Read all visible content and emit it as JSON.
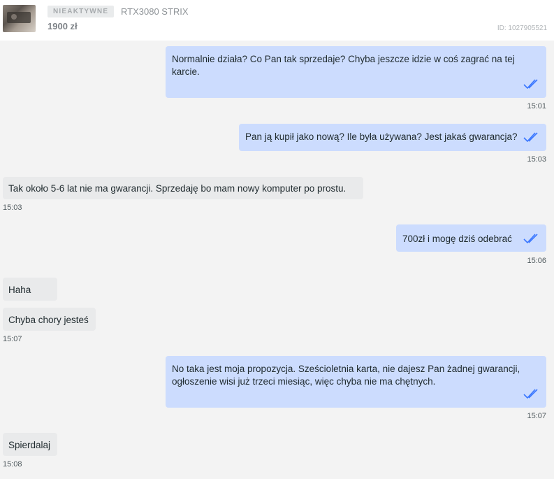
{
  "listing": {
    "status": "NIEAKTYWNE",
    "title": "RTX3080 STRIX",
    "price": "1900 zł",
    "id_label": "ID: 1027905521",
    "image_alt": "graphics-card-photo"
  },
  "messages": [
    {
      "direction": "sent",
      "text": "Normalnie działa? Co Pan tak sprzedaje? Chyba jeszcze idzie w coś zagrać na tej karcie.",
      "time": "15:01",
      "read": true
    },
    {
      "direction": "sent",
      "text": "Pan ją kupił jako nową? Ile była używana? Jest jakaś gwarancja?",
      "time": "15:03",
      "read": true
    },
    {
      "direction": "received",
      "text": "Tak około 5-6 lat nie ma gwarancji. Sprzedaję bo mam nowy komputer po prostu.",
      "time": "15:03"
    },
    {
      "direction": "sent",
      "text": "700zł i mogę dziś odebrać",
      "time": "15:06",
      "read": true
    },
    {
      "direction": "received",
      "text": "Haha",
      "time": ""
    },
    {
      "direction": "received",
      "text": "Chyba chory jesteś",
      "time": "15:07"
    },
    {
      "direction": "sent",
      "text": "No taka jest moja propozycja. Sześcioletnia karta, nie dajesz Pan żadnej gwarancji, ogłoszenie wisi już trzeci miesiąc, więc chyba nie ma chętnych.",
      "time": "15:07",
      "read": true
    },
    {
      "direction": "received",
      "text": "Spierdalaj",
      "time": "15:08"
    }
  ],
  "colors": {
    "sent_bubble": "#ccdcfe",
    "received_bubble": "#e9eaeb",
    "read_ticks": "#3a77ff",
    "background": "#f3f3f3"
  },
  "icons": {
    "read_receipt": "double-check-icon"
  }
}
